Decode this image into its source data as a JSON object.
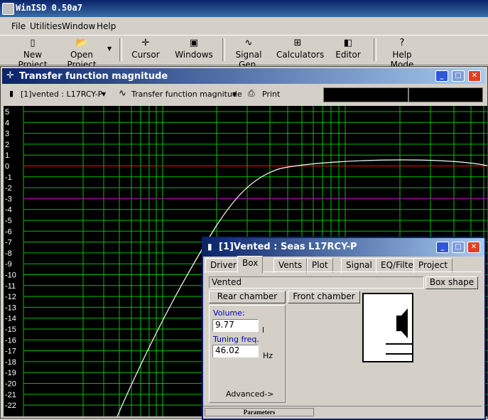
{
  "app": {
    "title": "WinISD 0.50a7"
  },
  "menu": [
    "File",
    "Utilities",
    "Window",
    "Help"
  ],
  "toolbar": [
    {
      "label": "New Project",
      "icon": "new-project-icon",
      "glyph": "▯"
    },
    {
      "label": "Open Project",
      "icon": "open-project-icon",
      "glyph": "📂"
    },
    {
      "label": "Cursor",
      "icon": "cursor-icon",
      "glyph": "✛"
    },
    {
      "label": "Windows",
      "icon": "windows-icon",
      "glyph": "▣"
    },
    {
      "label": "Signal Gen.",
      "icon": "signal-gen-icon",
      "glyph": "∿"
    },
    {
      "label": "Calculators",
      "icon": "calculators-icon",
      "glyph": "⊞"
    },
    {
      "label": "Editor",
      "icon": "editor-icon",
      "glyph": "◧"
    },
    {
      "label": "Help Mode",
      "icon": "help-mode-icon",
      "glyph": "?"
    }
  ],
  "transfer_window": {
    "title": "Transfer function magnitude",
    "project_select": "[1]vented : L17RCY-P",
    "graph_select": "Transfer function magnitude",
    "print_label": "Print"
  },
  "plot": {
    "y_ticks": [
      "5",
      "4",
      "3",
      "2",
      "1",
      "0",
      "-1",
      "-2",
      "-3",
      "-4",
      "-5",
      "-6",
      "-7",
      "-8",
      "-9",
      "-10",
      "-11",
      "-12",
      "-13",
      "-14",
      "-15",
      "-16",
      "-17",
      "-18",
      "-19",
      "-20",
      "-21",
      "-22"
    ],
    "colors": {
      "grid": "#00c000",
      "zero_line": "#ff0000",
      "minus3_line": "#c000c0",
      "curve": "#ffffff"
    }
  },
  "vented_dialog": {
    "title": "[1]Vented : Seas L17RCY-P",
    "tabs": [
      "Driver",
      "Box",
      "Vents",
      "Plot",
      "Signal",
      "EQ/Filter",
      "Project"
    ],
    "active_tab": "Box",
    "box_type": "Vented",
    "box_shape_button": "Box shape",
    "rear_chamber_label": "Rear chamber",
    "front_chamber_label": "Front chamber",
    "volume_label": "Volume:",
    "volume_value": "9.77",
    "volume_unit": "l",
    "tuning_label": "Tuning freq.",
    "tuning_value": "46.02",
    "tuning_unit": "Hz",
    "advanced_label": "Advanced->",
    "status_label": "Parameters"
  }
}
